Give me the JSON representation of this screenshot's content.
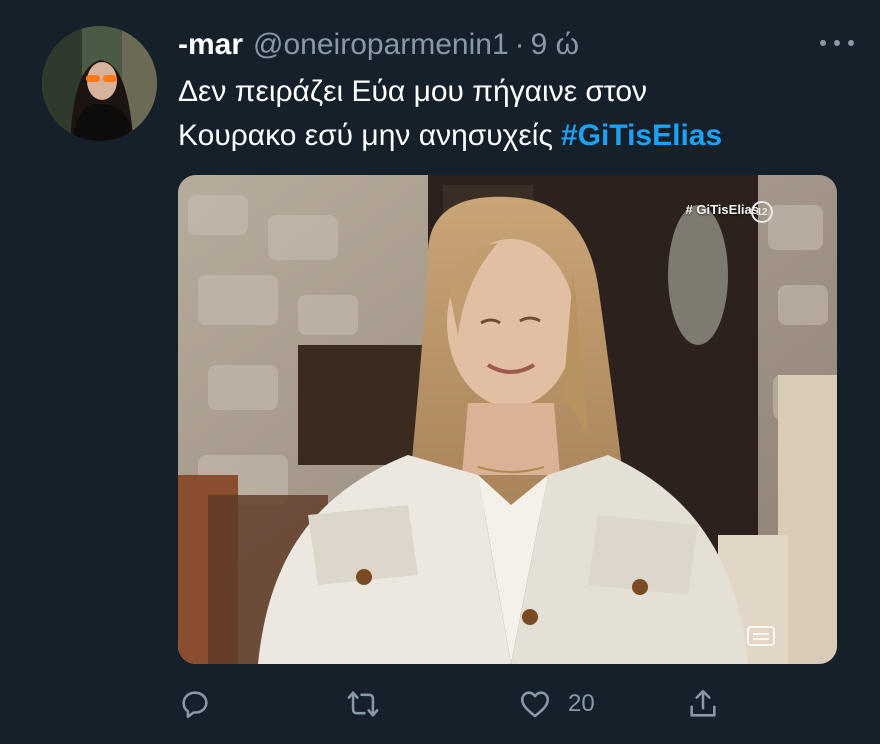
{
  "tweet": {
    "display_name": "-mar",
    "handle": "@oneiroparmenin1",
    "separator": "·",
    "time": "9 ώ",
    "text_line1": "Δεν πειράζει Εύα μου πήγαινε στον",
    "text_line2": "Κουρακο εσύ μην ανησυχείς",
    "hashtag": "#GiTisElias"
  },
  "media": {
    "watermark": "# GiTisElias",
    "channel": "12"
  },
  "actions": {
    "reply_icon": "reply-icon",
    "retweet_icon": "retweet-icon",
    "like_icon": "heart-icon",
    "like_count": "20",
    "share_icon": "share-icon"
  },
  "colors": {
    "background": "#15202b",
    "accent": "#1da1f2",
    "secondary_text": "#8899a6"
  }
}
